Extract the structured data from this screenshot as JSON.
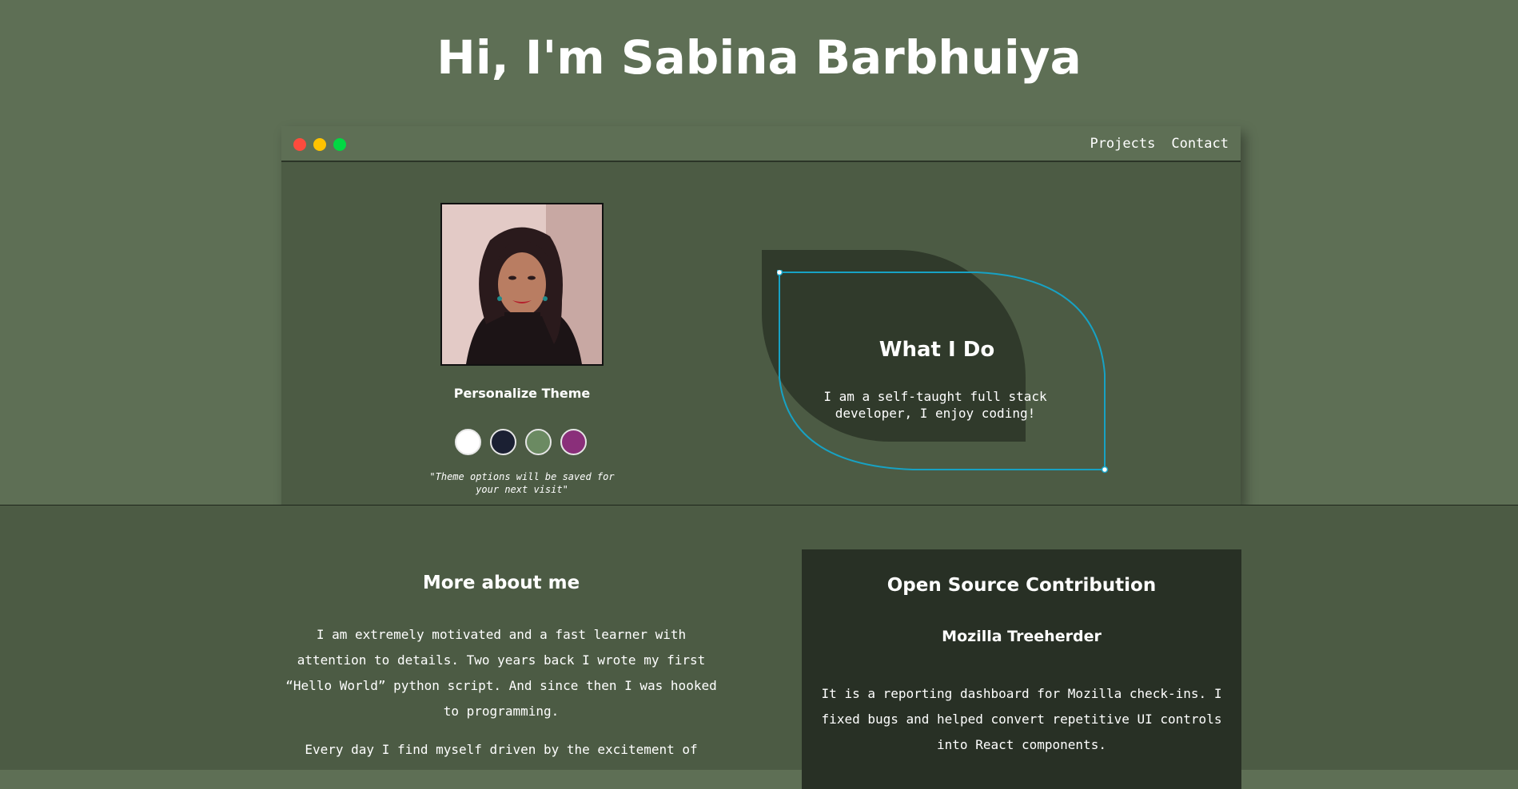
{
  "page": {
    "title": "Hi, I'm Sabina Barbhuiya"
  },
  "nav": {
    "items": [
      "Projects",
      "Contact"
    ]
  },
  "window_controls": {
    "colors": [
      "#fd4b3d",
      "#fec300",
      "#02d843"
    ]
  },
  "profile": {
    "photo_icon": "profile-photo"
  },
  "theme": {
    "title": "Personalize Theme",
    "swatches": [
      {
        "name": "light",
        "color": "#ffffff"
      },
      {
        "name": "dark-blue",
        "color": "#1b2033"
      },
      {
        "name": "green",
        "color": "#6b8a62"
      },
      {
        "name": "purple",
        "color": "#8a2f7a"
      }
    ],
    "note": "\"Theme options will be saved for your next visit\""
  },
  "what_i_do": {
    "title": "What I Do",
    "text": "I am a self-taught full stack developer, I enjoy coding!",
    "outline_color": "#17a2c4"
  },
  "about": {
    "heading": "More about me",
    "paragraph1": "I am extremely motivated and a fast learner with attention to details. Two years back I wrote my first “Hello World” python script. And since then I was hooked to programming.",
    "paragraph2": "Every day I find myself driven by the excitement of"
  },
  "open_source": {
    "heading": "Open Source Contribution",
    "project": "Mozilla Treeherder",
    "description": "It is a reporting dashboard for Mozilla check-ins. I fixed bugs and helped convert repetitive UI controls into React components."
  }
}
